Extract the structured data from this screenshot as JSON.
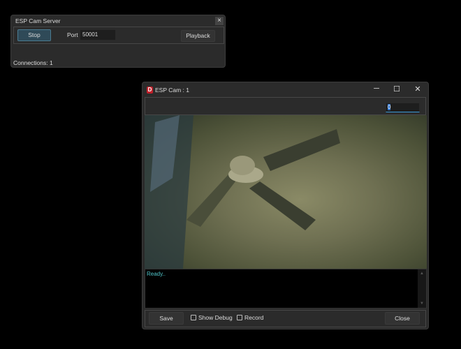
{
  "server": {
    "title": "ESP Cam Server",
    "close_icon": "×",
    "stop_label": "Stop",
    "port_label": "Port",
    "port_value": "50001",
    "playback_label": "Playback",
    "connections": "Connections: 1"
  },
  "cam": {
    "title": "ESP Cam : 1",
    "app_icon_letter": "D",
    "minimize": "─",
    "maximize": "☐",
    "close": "✕",
    "frame_value": "0",
    "log_text": "Ready..",
    "log_color": "#4fc3c8",
    "save_label": "Save",
    "show_debug_label": "Show Debug",
    "record_label": "Record",
    "close_label": "Close",
    "scroll_up": "▲",
    "scroll_down": "▼"
  }
}
